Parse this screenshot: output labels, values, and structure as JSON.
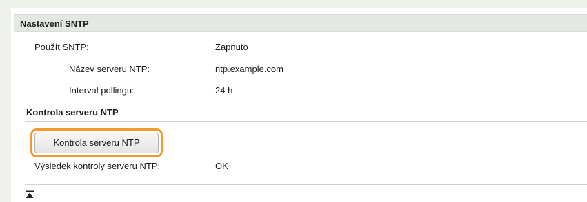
{
  "section": {
    "title": "Nastavení SNTP"
  },
  "settings": {
    "use_sntp_label": "Použít SNTP:",
    "use_sntp_value": "Zapnuto",
    "ntp_server_name_label": "Název serveru NTP:",
    "ntp_server_name_value": "ntp.example.com",
    "polling_interval_label": "Interval pollingu:",
    "polling_interval_value": "24 h"
  },
  "ntp_check": {
    "title": "Kontrola serveru NTP",
    "button_label": "Kontrola serveru NTP",
    "result_label": "Výsledek kontroly serveru NTP:",
    "result_value": "OK"
  },
  "highlight_color": "#f39b2b",
  "icons": {
    "back_to_top": "back-to-top-icon"
  }
}
